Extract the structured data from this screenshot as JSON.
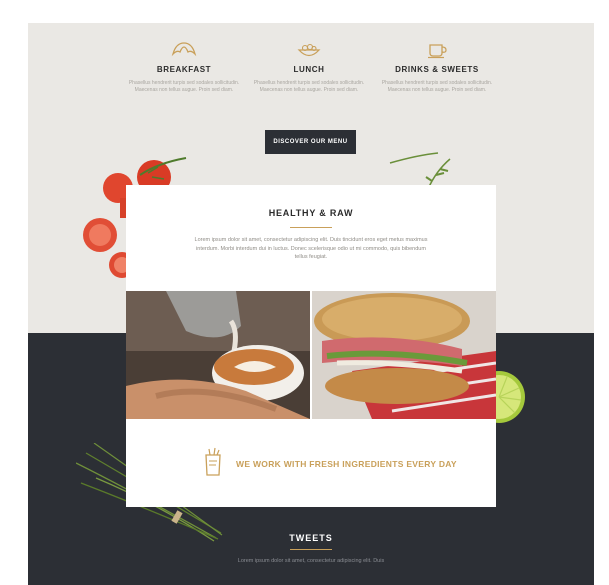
{
  "features": [
    {
      "icon": "croissant-icon",
      "title": "BREAKFAST",
      "text": "Phasellus hendrerit turpis sed sodales sollicitudin. Maecenas non tellus augue. Proin sed diam."
    },
    {
      "icon": "bowl-icon",
      "title": "LUNCH",
      "text": "Phasellus hendrerit turpis sed sodales sollicitudin. Maecenas non tellus augue. Proin sed diam."
    },
    {
      "icon": "coffee-cup-icon",
      "title": "DRINKS & SWEETS",
      "text": "Phasellus hendrerit turpis sed sodales sollicitudin. Maecenas non tellus augue. Proin sed diam."
    }
  ],
  "discover_button": "DISCOVER OUR MENU",
  "healthy": {
    "title": "HEALTHY & RAW",
    "description": "Lorem ipsum dolor sit amet, consectetur adipiscing elit. Duis tincidunt eros eget metus maximus interdum. Morbi interdum dui in luctus. Donec scelerisque odio ut mi commodo, quis bibendum tellus feugiat."
  },
  "fresh_text": "WE WORK WITH FRESH INGREDIENTS EVERY DAY",
  "tweets": {
    "title": "TWEETS",
    "text": "Lorem ipsum dolor sit amet, consectetur adipiscing elit. Duis"
  },
  "colors": {
    "accent": "#c9a05a",
    "dark": "#2c2f35",
    "light_bg": "#eae8e4"
  }
}
